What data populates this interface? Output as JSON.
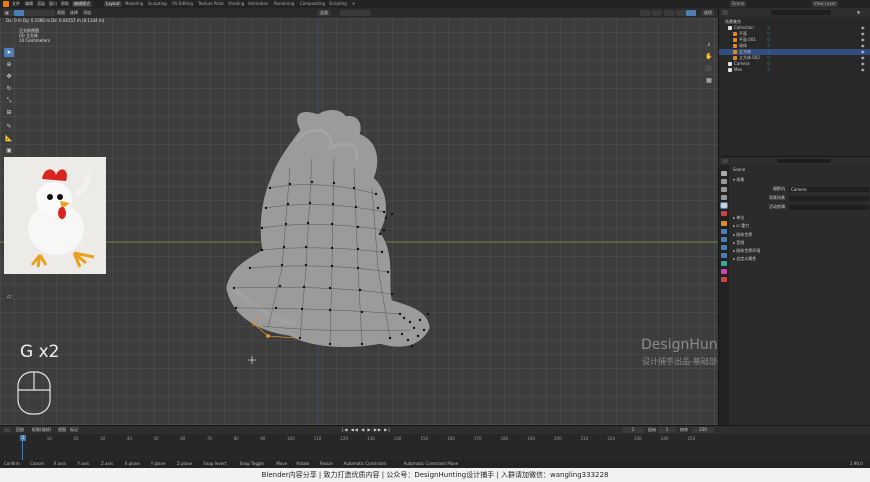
{
  "menubar": {
    "items": [
      "文件",
      "编辑",
      "渲染",
      "窗口",
      "帮助"
    ],
    "workspace_tabs": [
      "Layout",
      "Modeling",
      "Sculpting",
      "UV Editing",
      "Texture Paint",
      "Shading",
      "Animation",
      "Rendering",
      "Compositing",
      "Scripting"
    ],
    "active_tab": "Layout",
    "scene_label": "Scene",
    "view_layer_label": "View Layer"
  },
  "viewport_header": {
    "mode": "编辑模式",
    "view_menu": "视图",
    "select_menu": "选择",
    "add_menu": "添加",
    "orientation": "全局",
    "overlay_label": "选项"
  },
  "viewport_info": {
    "stats": "Dx: 0 m   Dy: 0.1066 m   Dz: 0.04157 m (0.1144 m)",
    "view_name": "正交前视图",
    "collection": "(0) 立方体",
    "units": "10 Centimeters"
  },
  "overlay": {
    "shortcut_hint": "G x2",
    "watermark_title": "DesignHunting",
    "watermark_subtitle": "设计捕手出品-基础部分"
  },
  "outliner": {
    "header": "场景集合",
    "search_placeholder": "",
    "rows": [
      {
        "label": "Collection",
        "depth": 1,
        "selected": false
      },
      {
        "label": "平面",
        "depth": 2,
        "selected": false
      },
      {
        "label": "平面.001",
        "depth": 2,
        "selected": false
      },
      {
        "label": "球体",
        "depth": 2,
        "selected": false
      },
      {
        "label": "立方体",
        "depth": 2,
        "selected": true
      },
      {
        "label": "立方体.002",
        "depth": 2,
        "selected": false
      },
      {
        "label": "Camera",
        "depth": 1,
        "selected": false
      },
      {
        "label": "Mes",
        "depth": 1,
        "selected": false
      }
    ]
  },
  "properties": {
    "context": "Scene",
    "section_title": "场景",
    "camera_label": "摄影机",
    "camera_value": "Camera",
    "background_label": "背景场景",
    "active_clip_label": "活动剪辑",
    "panels": [
      "单位",
      "重力",
      "刚体世界",
      "音频",
      "刚体世界环境",
      "自定义属性"
    ]
  },
  "timeline": {
    "menus": [
      "回放",
      "抠像(插帧)",
      "视图",
      "标记"
    ],
    "current_frame": "1",
    "start_label": "起始",
    "start": "1",
    "end_label": "结束",
    "end": "250",
    "ticks": [
      "0",
      "10",
      "20",
      "30",
      "40",
      "50",
      "60",
      "70",
      "80",
      "90",
      "100",
      "110",
      "120",
      "130",
      "140",
      "150",
      "160",
      "170",
      "180",
      "190",
      "200",
      "210",
      "220",
      "230",
      "240",
      "250"
    ]
  },
  "statusbar": {
    "items": [
      "Confirm",
      "Cancel",
      "X axis",
      "Y axis",
      "Z axis",
      "X plane",
      "Y plane",
      "Z plane",
      "Snap Invert",
      "Snap Toggle",
      "Move",
      "Rotate",
      "Resize",
      "Automatic Constraint",
      "Automatic Constraint Plane"
    ],
    "version": "2.90.0"
  },
  "caption": "Blender内容分享  |  致力打造优质内容  |  公众号：DesignHunting设计捕手  |  入群请加微信：wangling333228",
  "colors": {
    "accent": "#4a7fb5",
    "selected_edge": "#e08a2a",
    "x_axis": "#8bab3c",
    "viewport_bg": "#3d3d3d"
  }
}
